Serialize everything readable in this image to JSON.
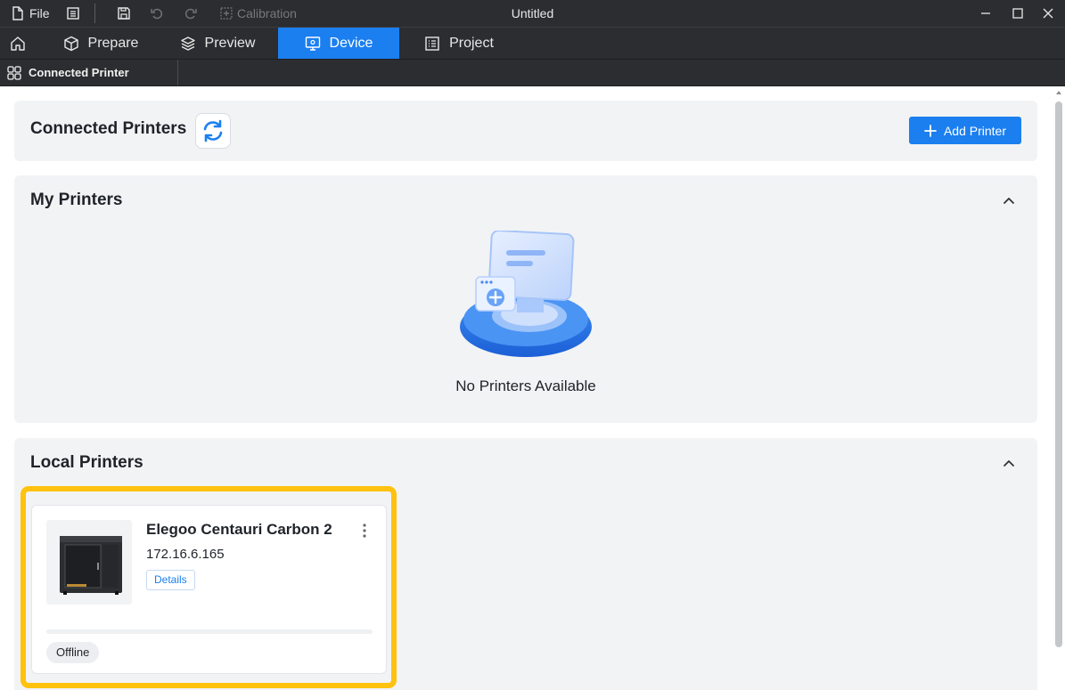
{
  "titlebar": {
    "file_label": "File",
    "calibration_label": "Calibration",
    "window_title": "Untitled"
  },
  "tabs": [
    {
      "label": "Prepare",
      "icon": "cube-icon"
    },
    {
      "label": "Preview",
      "icon": "layers-icon"
    },
    {
      "label": "Device",
      "icon": "monitor-icon",
      "active": true
    },
    {
      "label": "Project",
      "icon": "list-icon"
    }
  ],
  "subtab": {
    "label": "Connected Printer"
  },
  "header": {
    "title": "Connected Printers",
    "add_label": "Add Printer"
  },
  "my_printers": {
    "title": "My Printers",
    "empty_text": "No Printers Available"
  },
  "local_printers": {
    "title": "Local Printers",
    "items": [
      {
        "name": "Elegoo Centauri Carbon 2",
        "ip": "172.16.6.165",
        "details_label": "Details",
        "status": "Offline"
      }
    ]
  },
  "colors": {
    "accent": "#1b7ff0",
    "highlight": "#ffc20e",
    "titlebar_bg": "#2b2d30"
  }
}
